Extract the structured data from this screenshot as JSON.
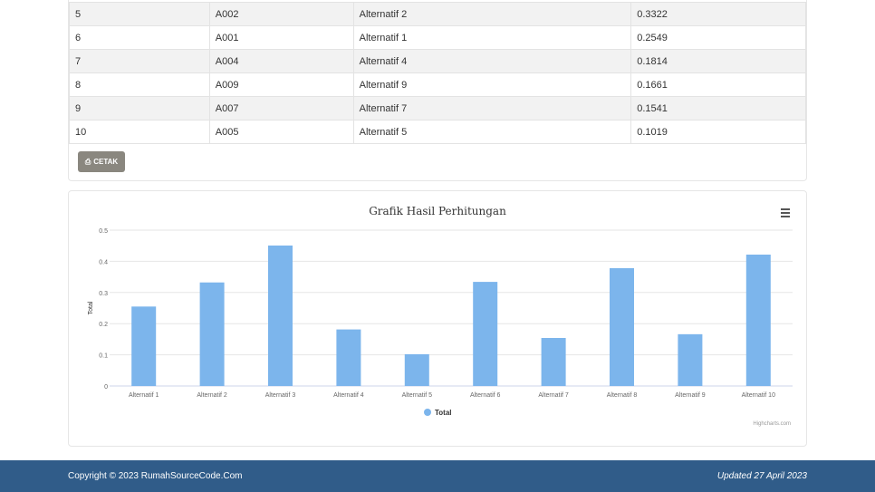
{
  "table": {
    "rows": [
      [
        "5",
        "A002",
        "Alternatif 2",
        "0.3322"
      ],
      [
        "6",
        "A001",
        "Alternatif 1",
        "0.2549"
      ],
      [
        "7",
        "A004",
        "Alternatif 4",
        "0.1814"
      ],
      [
        "8",
        "A009",
        "Alternatif 9",
        "0.1661"
      ],
      [
        "9",
        "A007",
        "Alternatif 7",
        "0.1541"
      ],
      [
        "10",
        "A005",
        "Alternatif 5",
        "0.1019"
      ]
    ]
  },
  "print_label": "CETAK",
  "chart_data": {
    "type": "bar",
    "title": "Grafik Hasil Perhitungan",
    "ylabel": "Total",
    "xlabel": "",
    "categories": [
      "Alternatif 1",
      "Alternatif 2",
      "Alternatif 3",
      "Alternatif 4",
      "Alternatif 5",
      "Alternatif 6",
      "Alternatif 7",
      "Alternatif 8",
      "Alternatif 9",
      "Alternatif 10"
    ],
    "values": [
      0.2549,
      0.3322,
      0.4506,
      0.1814,
      0.1019,
      0.334,
      0.1541,
      0.378,
      0.1661,
      0.4215
    ],
    "ylim": [
      0,
      0.5
    ],
    "yticks": [
      "0",
      "0.1",
      "0.2",
      "0.3",
      "0.4",
      "0.5"
    ],
    "legend": "Total",
    "legend_position": "bottom",
    "credits": "Highcharts.com",
    "color": "#7cb5ec",
    "grid": true
  },
  "footer": {
    "copyright": "Copyright © 2023 RumahSourceCode.Com",
    "updated": "Updated 27 April 2023"
  }
}
